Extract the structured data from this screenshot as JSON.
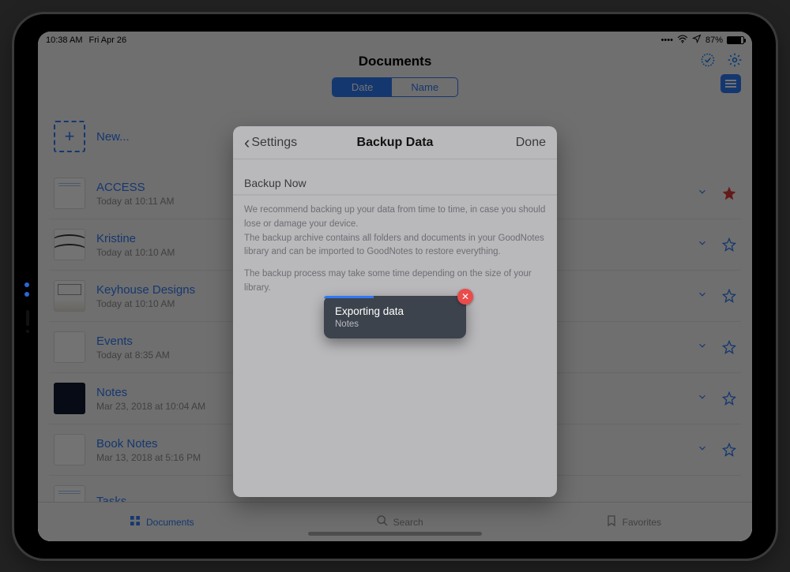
{
  "status": {
    "time": "10:38 AM",
    "date": "Fri Apr 26",
    "battery": "87%"
  },
  "nav": {
    "title": "Documents"
  },
  "segmented": {
    "date": "Date",
    "name": "Name"
  },
  "new_label": "New...",
  "documents": [
    {
      "title": "ACCESS",
      "subtitle": "Today at 10:11 AM",
      "starred": true
    },
    {
      "title": "Kristine",
      "subtitle": "Today at 10:10 AM",
      "starred": false
    },
    {
      "title": "Keyhouse Designs",
      "subtitle": "Today at 10:10 AM",
      "starred": false
    },
    {
      "title": "Events",
      "subtitle": "Today at 8:35 AM",
      "starred": false
    },
    {
      "title": "Notes",
      "subtitle": "Mar 23, 2018 at 10:04 AM",
      "starred": false
    },
    {
      "title": "Book Notes",
      "subtitle": "Mar 13, 2018 at 5:16 PM",
      "starred": false
    },
    {
      "title": "Tasks",
      "subtitle": "",
      "starred": false
    }
  ],
  "tabs": {
    "documents": "Documents",
    "search": "Search",
    "favorites": "Favorites"
  },
  "modal": {
    "back": "Settings",
    "title": "Backup Data",
    "done": "Done",
    "section": "Backup Now",
    "desc1": "We recommend backing up your data from time to time, in case you should lose or damage your device.",
    "desc2": "The backup archive contains all folders and documents in your GoodNotes library and can be imported to GoodNotes to restore everything.",
    "desc3": "The backup process may take some time depending on the size of your library."
  },
  "toast": {
    "title": "Exporting data",
    "subtitle": "Notes"
  }
}
